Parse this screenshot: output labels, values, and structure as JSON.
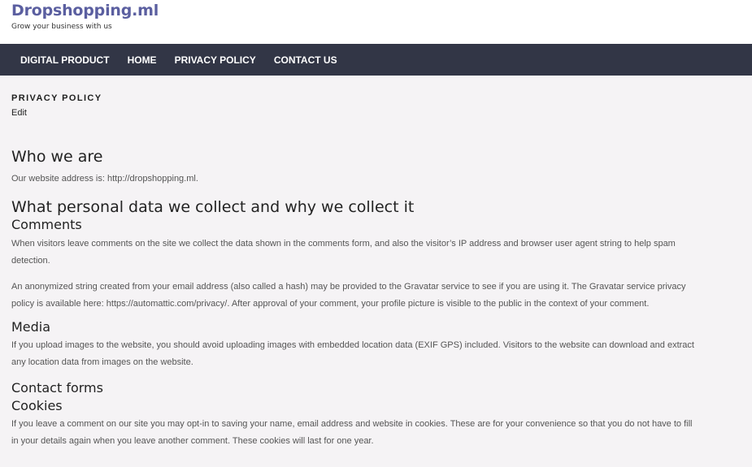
{
  "header": {
    "site_title": "Dropshopping.ml",
    "tagline": "Grow your business with us"
  },
  "nav": {
    "items": [
      {
        "label": "DIGITAL PRODUCT"
      },
      {
        "label": "HOME"
      },
      {
        "label": "PRIVACY POLICY"
      },
      {
        "label": "CONTACT US"
      }
    ]
  },
  "page": {
    "title": "PRIVACY POLICY",
    "edit_label": "Edit"
  },
  "content": {
    "who_heading": "Who we are",
    "who_text": "Our website address is: http://dropshopping.ml.",
    "what_heading": "What personal data we collect and why we collect it",
    "comments_heading": "Comments",
    "comments_p1": "When visitors leave comments on the site we collect the data shown in the comments form, and also the visitor’s IP address and browser user agent string to help spam detection.",
    "comments_p2": "An anonymized string created from your email address (also called a hash) may be provided to the Gravatar service to see if you are using it. The Gravatar service privacy policy is available here: https://automattic.com/privacy/. After approval of your comment, your profile picture is visible to the public in the context of your comment.",
    "media_heading": "Media",
    "media_text": "If you upload images to the website, you should avoid uploading images with embedded location data (EXIF GPS) included. Visitors to the website can download and extract any location data from images on the website.",
    "contact_heading": "Contact forms",
    "cookies_heading": "Cookies",
    "cookies_text": "If you leave a comment on our site you may opt-in to saving your name, email address and website in cookies. These are for your convenience so that you do not have to fill in your details again when you leave another comment. These cookies will last for one year."
  }
}
